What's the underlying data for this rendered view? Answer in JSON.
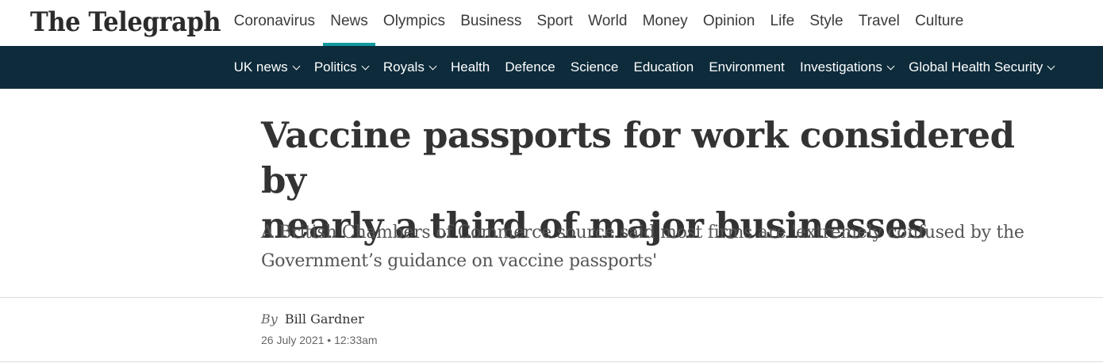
{
  "brand": {
    "logo_text": "The Telegraph"
  },
  "primary_nav": [
    {
      "label": "Coronavirus",
      "active": false
    },
    {
      "label": "News",
      "active": true
    },
    {
      "label": "Olympics",
      "active": false
    },
    {
      "label": "Business",
      "active": false
    },
    {
      "label": "Sport",
      "active": false
    },
    {
      "label": "World",
      "active": false
    },
    {
      "label": "Money",
      "active": false
    },
    {
      "label": "Opinion",
      "active": false
    },
    {
      "label": "Life",
      "active": false
    },
    {
      "label": "Style",
      "active": false
    },
    {
      "label": "Travel",
      "active": false
    },
    {
      "label": "Culture",
      "active": false
    }
  ],
  "secondary_nav": [
    {
      "label": "UK news",
      "has_dropdown": true
    },
    {
      "label": "Politics",
      "has_dropdown": true
    },
    {
      "label": "Royals",
      "has_dropdown": true
    },
    {
      "label": "Health",
      "has_dropdown": false
    },
    {
      "label": "Defence",
      "has_dropdown": false
    },
    {
      "label": "Science",
      "has_dropdown": false
    },
    {
      "label": "Education",
      "has_dropdown": false
    },
    {
      "label": "Environment",
      "has_dropdown": false
    },
    {
      "label": "Investigations",
      "has_dropdown": true
    },
    {
      "label": "Global Health Security",
      "has_dropdown": true
    }
  ],
  "article": {
    "headline_line1": "Vaccine passports for work considered by",
    "headline_line2": "nearly a third of major businesses",
    "standfirst_line1": "A British Chambers of Commerce source said most firms are 'extremely confused by the",
    "standfirst_line2": "Government’s guidance on vaccine passports'",
    "by_label": "By",
    "author": "Bill Gardner",
    "date": "26 July 2021 • 12:33am"
  },
  "colors": {
    "accent": "#119a9f",
    "subnav_bg": "#0d2b3b"
  }
}
